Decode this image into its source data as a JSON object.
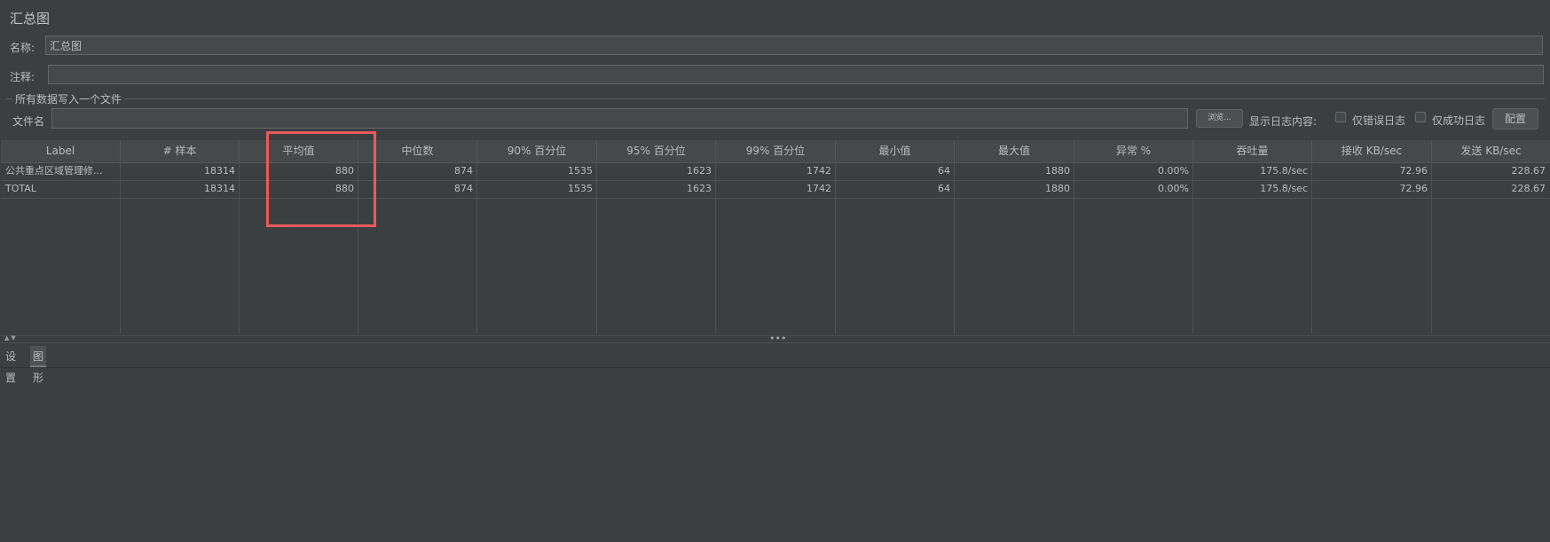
{
  "panel": {
    "title": "汇总图",
    "name_label": "名称:",
    "name_value": "汇总图",
    "comment_label": "注释:",
    "comment_value": ""
  },
  "file_group": {
    "title": "所有数据写入一个文件",
    "filename_label": "文件名",
    "filename_value": "",
    "browse_label": "浏览...",
    "log_content_label": "显示日志内容:",
    "errors_only_label": "仅错误日志",
    "success_only_label": "仅成功日志",
    "configure_label": "配置"
  },
  "table": {
    "columns": [
      "Label",
      "# 样本",
      "平均值",
      "中位数",
      "90% 百分位",
      "95% 百分位",
      "99% 百分位",
      "最小值",
      "最大值",
      "异常 %",
      "吞吐量",
      "接收 KB/sec",
      "发送 KB/sec"
    ],
    "rows": [
      [
        "公共重点区域管理修...",
        "18314",
        "880",
        "874",
        "1535",
        "1623",
        "1742",
        "64",
        "1880",
        "0.00%",
        "175.8/sec",
        "72.96",
        "228.67"
      ],
      [
        "TOTAL",
        "18314",
        "880",
        "874",
        "1535",
        "1623",
        "1742",
        "64",
        "1880",
        "0.00%",
        "175.8/sec",
        "72.96",
        "228.67"
      ]
    ]
  },
  "splitter": {
    "arrows": "▲▼",
    "dots": "•••"
  },
  "bottom_tabs": {
    "settings_label": "设置",
    "graph_label": "图形"
  },
  "colors": {
    "background": "#3c3f41",
    "highlight": "#e85b5b"
  }
}
